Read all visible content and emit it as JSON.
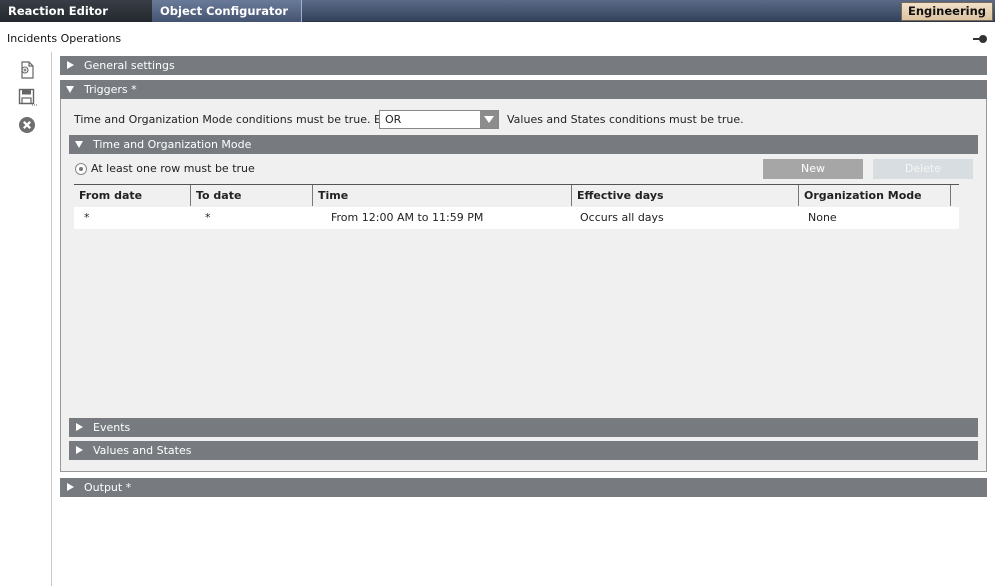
{
  "tabs": [
    {
      "label": "Reaction Editor",
      "active": true
    },
    {
      "label": "Object Configurator",
      "active": false
    }
  ],
  "workspace_label": "Engineering",
  "breadcrumb": "Incidents Operations",
  "sections": {
    "general": "General settings",
    "triggers": "Triggers *",
    "output": "Output *"
  },
  "triggers": {
    "condition_prefix": "Time and Organization Mode conditions must be true. Events",
    "operator": "OR",
    "condition_suffix": "Values and States conditions must be true.",
    "time_org": {
      "title": "Time and Organization Mode",
      "radio_label": "At least one row must be true",
      "new_label": "New",
      "delete_label": "Delete",
      "columns": [
        "From date",
        "To date",
        "Time",
        "Effective days",
        "Organization Mode"
      ],
      "rows": [
        [
          "*",
          "*",
          "From 12:00 AM to 11:59 PM",
          "Occurs all days",
          "None"
        ]
      ]
    },
    "events": "Events",
    "values_states": "Values and States"
  },
  "colors": {
    "header": "#777b80",
    "topbar": "#44536f",
    "workspace": "#e8d2b4"
  }
}
